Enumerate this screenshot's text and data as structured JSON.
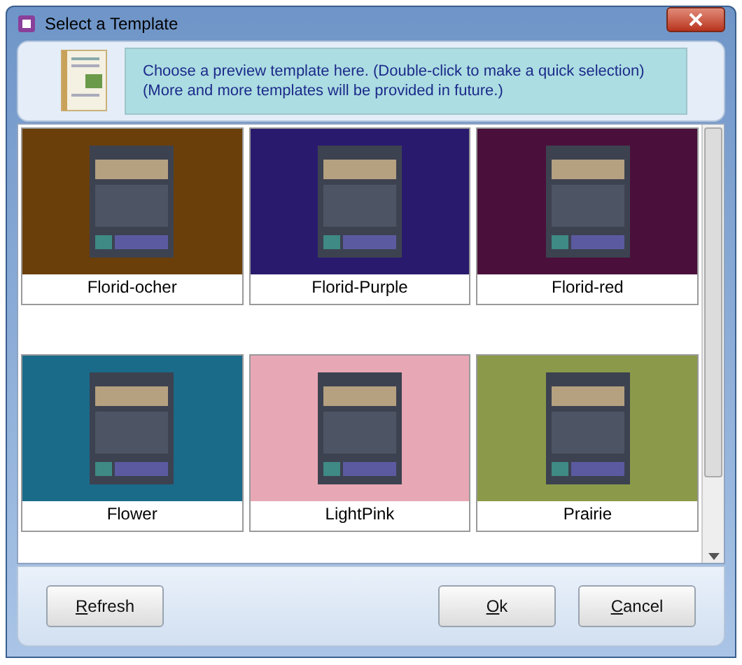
{
  "window": {
    "title": "Select a Template"
  },
  "header": {
    "lines": [
      "Choose a preview template here. (Double-click to make a quick selection)",
      "(More and more templates will be provided in future.)"
    ]
  },
  "templates": [
    {
      "name": "Florid-ocher",
      "color": "#6b3f0a"
    },
    {
      "name": "Florid-Purple",
      "color": "#2a1a6e"
    },
    {
      "name": "Florid-red",
      "color": "#4a0f3a"
    },
    {
      "name": "Flower",
      "color": "#1a6b8a"
    },
    {
      "name": "LightPink",
      "color": "#e8a7b4"
    },
    {
      "name": "Prairie",
      "color": "#8a9a4a"
    }
  ],
  "left_buttons": [
    {
      "label": "Refresh",
      "underline_first": true
    }
  ],
  "right_buttons": [
    {
      "label": "Ok",
      "underline_first": true
    },
    {
      "label": "Cancel",
      "underline_first": true
    }
  ]
}
